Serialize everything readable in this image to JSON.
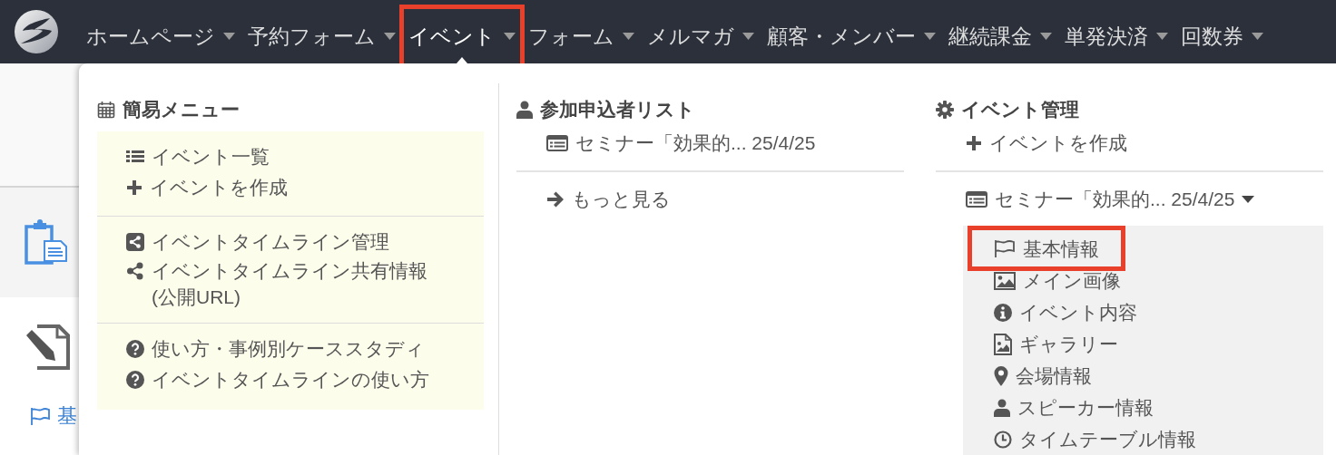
{
  "nav": {
    "items": [
      {
        "label": "ホームページ",
        "selected": false,
        "highlighted": false
      },
      {
        "label": "予約フォーム",
        "selected": false,
        "highlighted": false
      },
      {
        "label": "イベント",
        "selected": true,
        "highlighted": true
      },
      {
        "label": "フォーム",
        "selected": false,
        "highlighted": false
      },
      {
        "label": "メルマガ",
        "selected": false,
        "highlighted": false
      },
      {
        "label": "顧客・メンバー",
        "selected": false,
        "highlighted": false
      },
      {
        "label": "継続課金",
        "selected": false,
        "highlighted": false
      },
      {
        "label": "単発決済",
        "selected": false,
        "highlighted": false
      },
      {
        "label": "回数券",
        "selected": false,
        "highlighted": false
      }
    ]
  },
  "background_page": {
    "link": "基"
  },
  "quick_menu": {
    "title": "簡易メニュー",
    "groups": [
      [
        {
          "kind": "list",
          "label": "イベント一覧"
        },
        {
          "kind": "plus",
          "label": "イベントを作成"
        }
      ],
      [
        {
          "kind": "share-square",
          "label": "イベントタイムライン管理"
        },
        {
          "kind": "share",
          "label": "イベントタイムライン共有情報 (公開URL)"
        }
      ],
      [
        {
          "kind": "question",
          "label": "使い方・事例別ケーススタディ"
        },
        {
          "kind": "question",
          "label": "イベントタイムラインの使い方"
        }
      ]
    ]
  },
  "applicants": {
    "title": "参加申込者リスト",
    "items": [
      {
        "kind": "form",
        "label": "セミナー「効果的... 25/4/25"
      }
    ],
    "more": {
      "kind": "arrow",
      "label": "もっと見る"
    }
  },
  "event_admin": {
    "title": "イベント管理",
    "create": {
      "kind": "plus",
      "label": "イベントを作成"
    },
    "event": {
      "kind": "form",
      "label": "セミナー「効果的... 25/4/25",
      "expanded": true
    },
    "sub_items": [
      {
        "kind": "flag",
        "label": "基本情報",
        "highlighted": true
      },
      {
        "kind": "image",
        "label": "メイン画像",
        "highlighted": false
      },
      {
        "kind": "info",
        "label": "イベント内容",
        "highlighted": false
      },
      {
        "kind": "image-file",
        "label": "ギャラリー",
        "highlighted": false
      },
      {
        "kind": "pin",
        "label": "会場情報",
        "highlighted": false
      },
      {
        "kind": "user",
        "label": "スピーカー情報",
        "highlighted": false
      },
      {
        "kind": "clock",
        "label": "タイムテーブル情報",
        "highlighted": false
      }
    ]
  }
}
